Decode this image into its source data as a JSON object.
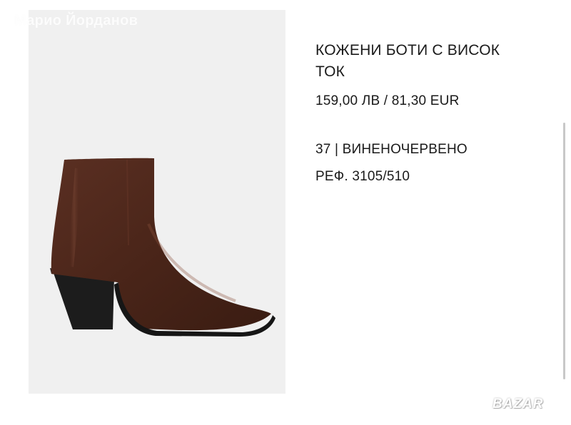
{
  "watermark": {
    "text": "Марио Йорданов"
  },
  "product": {
    "title_line1": "КОЖЕНИ БОТИ С ВИСОК",
    "title_line2": "ТОК",
    "price": "159,00 ЛВ / 81,30 EUR",
    "variant": "37 | ВИНЕНОЧЕРВЕНО",
    "reference": "РЕФ. 3105/510",
    "image_icon": "ankle-boot-image"
  },
  "site_logo": {
    "text": "BAZAR"
  },
  "colors": {
    "image_background": "#f0f0f0",
    "boot_leather": "#4a2519",
    "heel": "#1c1c1c",
    "text": "#1a1a1a"
  }
}
